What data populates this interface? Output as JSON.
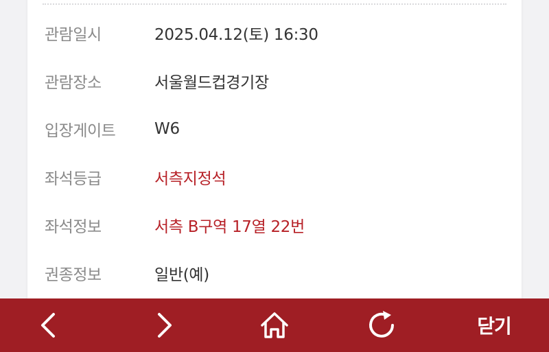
{
  "ticket": {
    "rows": [
      {
        "label": "관람일시",
        "value": "2025.04.12(토) 16:30"
      },
      {
        "label": "관람장소",
        "value": "서울월드컵경기장"
      },
      {
        "label": "입장게이트",
        "value": "W6"
      },
      {
        "label": "좌석등급",
        "value": "서측지정석"
      },
      {
        "label": "좌석정보",
        "value": "서측 B구역 17열 22번"
      },
      {
        "label": "권종정보",
        "value": "일반(예)"
      }
    ]
  },
  "toolbar": {
    "back_icon": "chevron-left-icon",
    "forward_icon": "chevron-right-icon",
    "home_icon": "home-icon",
    "refresh_icon": "refresh-icon",
    "close_label": "닫기"
  },
  "colors": {
    "toolbar_bg": "#9f1e24",
    "highlight_text": "#b72127",
    "label_text": "#8a8a8a",
    "value_text": "#333333"
  }
}
